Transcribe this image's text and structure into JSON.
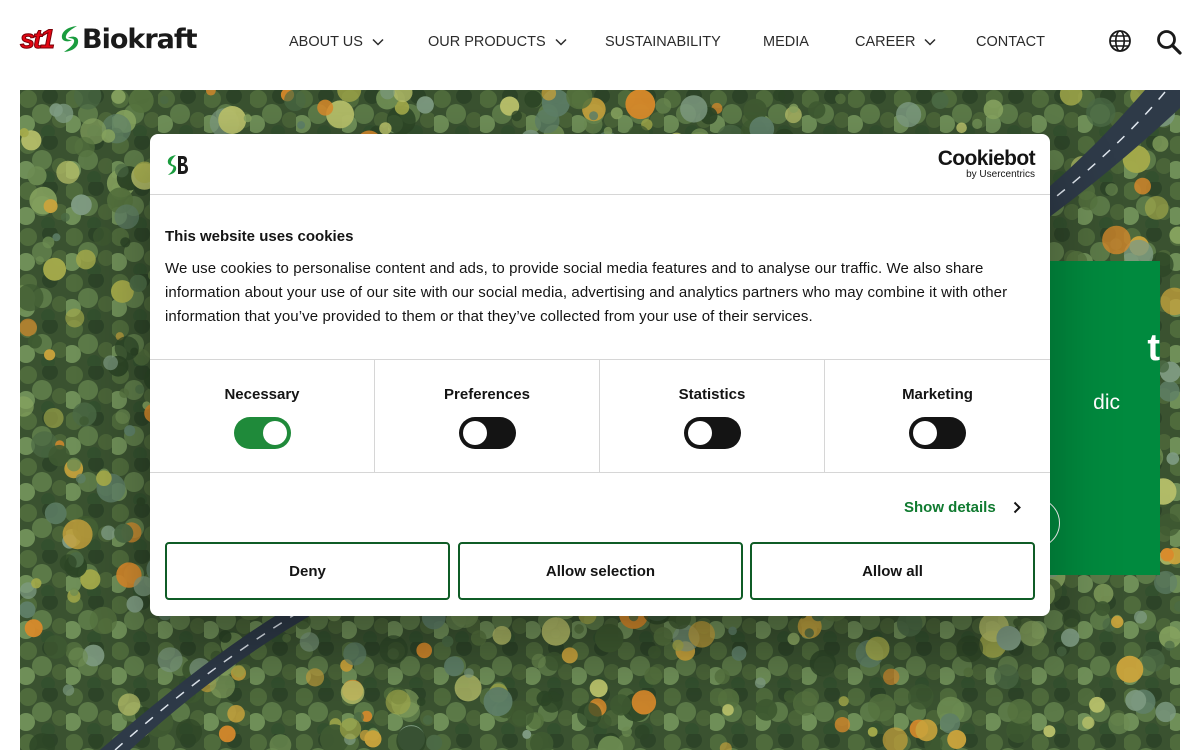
{
  "header": {
    "logo": {
      "brand_mark": "st1",
      "brand_name": "Biokraft",
      "logo_colors": {
        "st1_red": "#e30613",
        "leaf_green": "#1a9c3e",
        "text_dark": "#1a1a1a"
      }
    },
    "nav": [
      {
        "label": "ABOUT US",
        "has_dropdown": true
      },
      {
        "label": "OUR PRODUCTS",
        "has_dropdown": true
      },
      {
        "label": "SUSTAINABILITY",
        "has_dropdown": false
      },
      {
        "label": "MEDIA",
        "has_dropdown": false
      },
      {
        "label": "CAREER",
        "has_dropdown": true
      },
      {
        "label": "CONTACT",
        "has_dropdown": false
      }
    ],
    "icons": {
      "language": "globe-icon",
      "search": "search-icon"
    }
  },
  "hero": {
    "background": "aerial-forest-with-road",
    "card": {
      "title_fragment": "t",
      "text_fragment": "dic",
      "accent_color": "#008a3e"
    }
  },
  "cookie_dialog": {
    "brand_icon": "biokraft-leaf-icon",
    "provider_logo": {
      "name": "Cookiebot",
      "byline": "by Usercentrics"
    },
    "title": "This website uses cookies",
    "body": "We use cookies to personalise content and ads, to provide social media features and to analyse our traffic. We also share information about your use of our site with our social media, advertising and analytics partners who may combine it with other information that you’ve provided to them or that they’ve collected from your use of their services.",
    "categories": [
      {
        "label": "Necessary",
        "enabled": true
      },
      {
        "label": "Preferences",
        "enabled": false
      },
      {
        "label": "Statistics",
        "enabled": false
      },
      {
        "label": "Marketing",
        "enabled": false
      }
    ],
    "show_details_label": "Show details",
    "buttons": {
      "deny": "Deny",
      "allow_selection": "Allow selection",
      "allow_all": "Allow all"
    },
    "colors": {
      "toggle_on": "#1f8a3a",
      "toggle_off": "#141414",
      "link": "#0f7a2f",
      "button_border": "#0f5c26"
    }
  }
}
